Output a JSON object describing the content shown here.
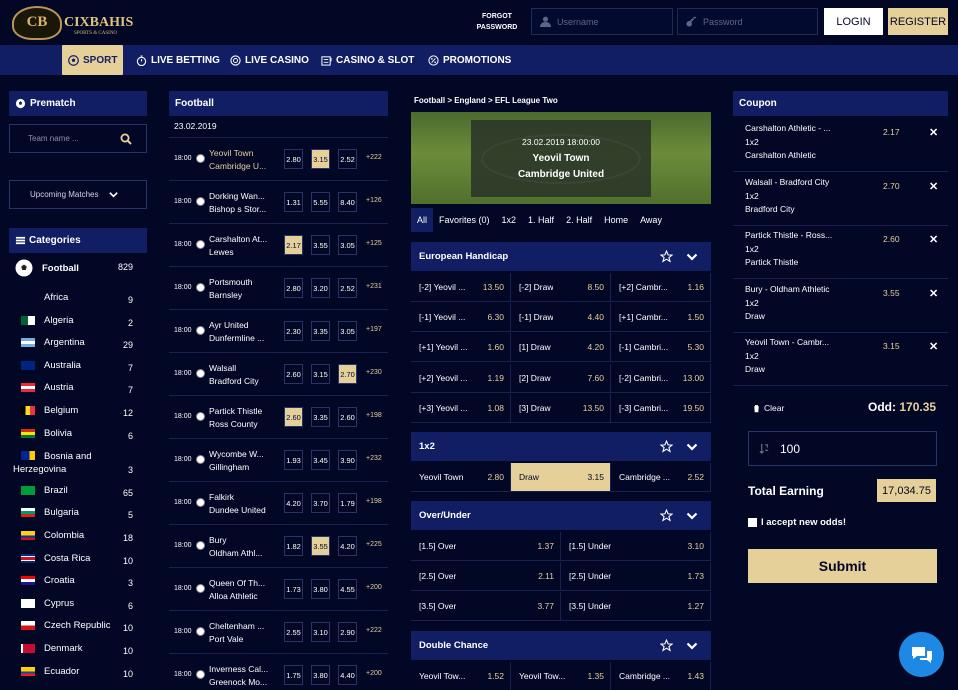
{
  "header": {
    "brand": "CIXBAHIS",
    "brand_sub": "SPORTS & CASINO",
    "crest": "CB",
    "forgot": "FORGOT PASSWORD",
    "username_placeholder": "Username",
    "password_placeholder": "Password",
    "login": "LOGIN",
    "register": "REGISTER"
  },
  "nav": [
    {
      "label": "SPORT",
      "icon": "soccer-ball-icon"
    },
    {
      "label": "LIVE BETTING",
      "icon": "stopwatch-icon"
    },
    {
      "label": "LIVE CASINO",
      "icon": "chip-icon"
    },
    {
      "label": "CASINO & SLOT",
      "icon": "slot-machine-icon"
    },
    {
      "label": "PROMOTIONS",
      "icon": "percent-icon"
    }
  ],
  "left": {
    "prematch": "Prematch",
    "search_placeholder": "Team name ...",
    "upcoming": "Upcoming Matches",
    "categories": "Categories",
    "sport": "Football",
    "sport_count": "829",
    "countries": [
      {
        "name": "Africa",
        "count": "9"
      },
      {
        "name": "Algeria",
        "count": "2"
      },
      {
        "name": "Argentina",
        "count": "29"
      },
      {
        "name": "Australia",
        "count": "7"
      },
      {
        "name": "Austria",
        "count": "7"
      },
      {
        "name": "Belgium",
        "count": "12"
      },
      {
        "name": "Bolivia",
        "count": "6"
      },
      {
        "name": "Bosnia and Herzegovina",
        "count": "3"
      },
      {
        "name": "Brazil",
        "count": "65"
      },
      {
        "name": "Bulgaria",
        "count": "5"
      },
      {
        "name": "Colombia",
        "count": "18"
      },
      {
        "name": "Costa Rica",
        "count": "10"
      },
      {
        "name": "Croatia",
        "count": "3"
      },
      {
        "name": "Cyprus",
        "count": "6"
      },
      {
        "name": "Czech Republic",
        "count": "10"
      },
      {
        "name": "Denmark",
        "count": "10"
      },
      {
        "name": "Ecuador",
        "count": "10"
      }
    ],
    "colors": {
      "accent": "#e6d09a",
      "panel": "#121e64",
      "bg": "#020726"
    }
  },
  "matches": {
    "title": "Football",
    "date": "23.02.2019",
    "list": [
      {
        "time": "18:00",
        "home": "Yeovil Town",
        "away": "Cambridge U...",
        "o1": "2.80",
        "ox": "3.15",
        "o2": "2.52",
        "more": "+222",
        "sel": 1,
        "gold": true
      },
      {
        "time": "18:00",
        "home": "Dorking Wan...",
        "away": "Bishop s Stor...",
        "o1": "1.31",
        "ox": "5.55",
        "o2": "8.40",
        "more": "+126",
        "sel": -1,
        "gold": false
      },
      {
        "time": "18:00",
        "home": "Carshalton At...",
        "away": "Lewes",
        "o1": "2.17",
        "ox": "3.55",
        "o2": "3.05",
        "more": "+125",
        "sel": 0,
        "gold": false
      },
      {
        "time": "18:00",
        "home": "Portsmouth",
        "away": "Barnsley",
        "o1": "2.80",
        "ox": "3.20",
        "o2": "2.52",
        "more": "+231",
        "sel": -1,
        "gold": false
      },
      {
        "time": "18:00",
        "home": "Ayr United",
        "away": "Dunfermline ...",
        "o1": "2.30",
        "ox": "3.35",
        "o2": "3.05",
        "more": "+197",
        "sel": -1,
        "gold": false
      },
      {
        "time": "18:00",
        "home": "Walsall",
        "away": "Bradford City",
        "o1": "2.60",
        "ox": "3.15",
        "o2": "2.70",
        "more": "+230",
        "sel": 2,
        "gold": false
      },
      {
        "time": "18:00",
        "home": "Partick Thistle",
        "away": "Ross County",
        "o1": "2.60",
        "ox": "3.35",
        "o2": "2.60",
        "more": "+198",
        "sel": 0,
        "gold": false
      },
      {
        "time": "18:00",
        "home": "Wycombe W...",
        "away": "Gillingham",
        "o1": "1.93",
        "ox": "3.45",
        "o2": "3.90",
        "more": "+232",
        "sel": -1,
        "gold": false
      },
      {
        "time": "18:00",
        "home": "Falkirk",
        "away": "Dundee United",
        "o1": "4.20",
        "ox": "3.70",
        "o2": "1.79",
        "more": "+198",
        "sel": -1,
        "gold": false
      },
      {
        "time": "18:00",
        "home": "Bury",
        "away": "Oldham Athl...",
        "o1": "1.82",
        "ox": "3.55",
        "o2": "4.20",
        "more": "+225",
        "sel": 1,
        "gold": false
      },
      {
        "time": "18:00",
        "home": "Queen Of Th...",
        "away": "Alloa Athletic",
        "o1": "1.73",
        "ox": "3.80",
        "o2": "4.55",
        "more": "+200",
        "sel": -1,
        "gold": false
      },
      {
        "time": "18:00",
        "home": "Cheltenham ...",
        "away": "Port Vale",
        "o1": "2.55",
        "ox": "3.10",
        "o2": "2.90",
        "more": "+222",
        "sel": -1,
        "gold": false
      },
      {
        "time": "18:00",
        "home": "Inverness Cal...",
        "away": "Greenock Mo...",
        "o1": "1.75",
        "ox": "3.80",
        "o2": "4.40",
        "more": "+200",
        "sel": -1,
        "gold": false
      }
    ]
  },
  "event": {
    "breadcrumb": "Football > England > EFL League Two",
    "datetime": "23.02.2019 18:00:00",
    "home": "Yeovil Town",
    "away": "Cambridge United",
    "tabs": [
      "All",
      "Favorites (0)",
      "1x2",
      "1. Half",
      "2. Half",
      "Home",
      "Away"
    ],
    "markets": [
      {
        "title": "European Handicap",
        "rows": [
          [
            {
              "l": "[-2] Yeovil ...",
              "v": "13.50"
            },
            {
              "l": "[-2] Draw",
              "v": "8.50"
            },
            {
              "l": "[+2] Cambr...",
              "v": "1.16"
            }
          ],
          [
            {
              "l": "[-1] Yeovil ...",
              "v": "6.30"
            },
            {
              "l": "[-1] Draw",
              "v": "4.40"
            },
            {
              "l": "[+1] Cambr...",
              "v": "1.50"
            }
          ],
          [
            {
              "l": "[+1] Yeovil ...",
              "v": "1.60"
            },
            {
              "l": "[1] Draw",
              "v": "4.20"
            },
            {
              "l": "[-1] Cambri...",
              "v": "5.30"
            }
          ],
          [
            {
              "l": "[+2] Yeovil ...",
              "v": "1.19"
            },
            {
              "l": "[2] Draw",
              "v": "7.60"
            },
            {
              "l": "[-2] Cambri...",
              "v": "13.00"
            }
          ],
          [
            {
              "l": "[+3] Yeovil ...",
              "v": "1.08"
            },
            {
              "l": "[3] Draw",
              "v": "13.50"
            },
            {
              "l": "[-3] Cambri...",
              "v": "19.50"
            }
          ]
        ]
      },
      {
        "title": "1x2",
        "rows": [
          [
            {
              "l": "Yeovil Town",
              "v": "2.80"
            },
            {
              "l": "Draw",
              "v": "3.15"
            },
            {
              "l": "Cambridge ...",
              "v": "2.52"
            }
          ]
        ]
      },
      {
        "title": "Over/Under",
        "rows": [
          [
            {
              "l": "[1.5] Over",
              "v": "1.37"
            },
            {
              "l": "[1.5] Under",
              "v": "3.10"
            }
          ],
          [
            {
              "l": "[2.5] Over",
              "v": "2.11"
            },
            {
              "l": "[2.5] Under",
              "v": "1.73"
            }
          ],
          [
            {
              "l": "[3.5] Over",
              "v": "3.77"
            },
            {
              "l": "[3.5] Under",
              "v": "1.27"
            }
          ]
        ]
      },
      {
        "title": "Double Chance",
        "rows": [
          [
            {
              "l": "Yeovil Tow...",
              "v": "1.52"
            },
            {
              "l": "Yeovil Tow...",
              "v": "1.35"
            },
            {
              "l": "Cambridge ...",
              "v": "1.43"
            }
          ]
        ]
      }
    ]
  },
  "coupon": {
    "title": "Coupon",
    "items": [
      {
        "match": "Carshalton Athletic - ...",
        "market": "1x2",
        "pick": "Carshalton Athletic",
        "odd": "2.17"
      },
      {
        "match": "Walsall - Bradford City",
        "market": "1x2",
        "pick": "Bradford City",
        "odd": "2.70"
      },
      {
        "match": "Partick Thistle - Ross...",
        "market": "1x2",
        "pick": "Partick Thistle",
        "odd": "2.60"
      },
      {
        "match": "Bury - Oldham Athletic",
        "market": "1x2",
        "pick": "Draw",
        "odd": "3.55"
      },
      {
        "match": "Yeovil Town - Cambr...",
        "market": "1x2",
        "pick": "Draw",
        "odd": "3.15"
      }
    ],
    "clear": "Clear",
    "odd_label": "Odd:",
    "odd_total": "170.35",
    "stake": "100",
    "total_label": "Total Earning",
    "total": "17,034.75",
    "accept": "I accept new odds!",
    "submit": "Submit"
  }
}
